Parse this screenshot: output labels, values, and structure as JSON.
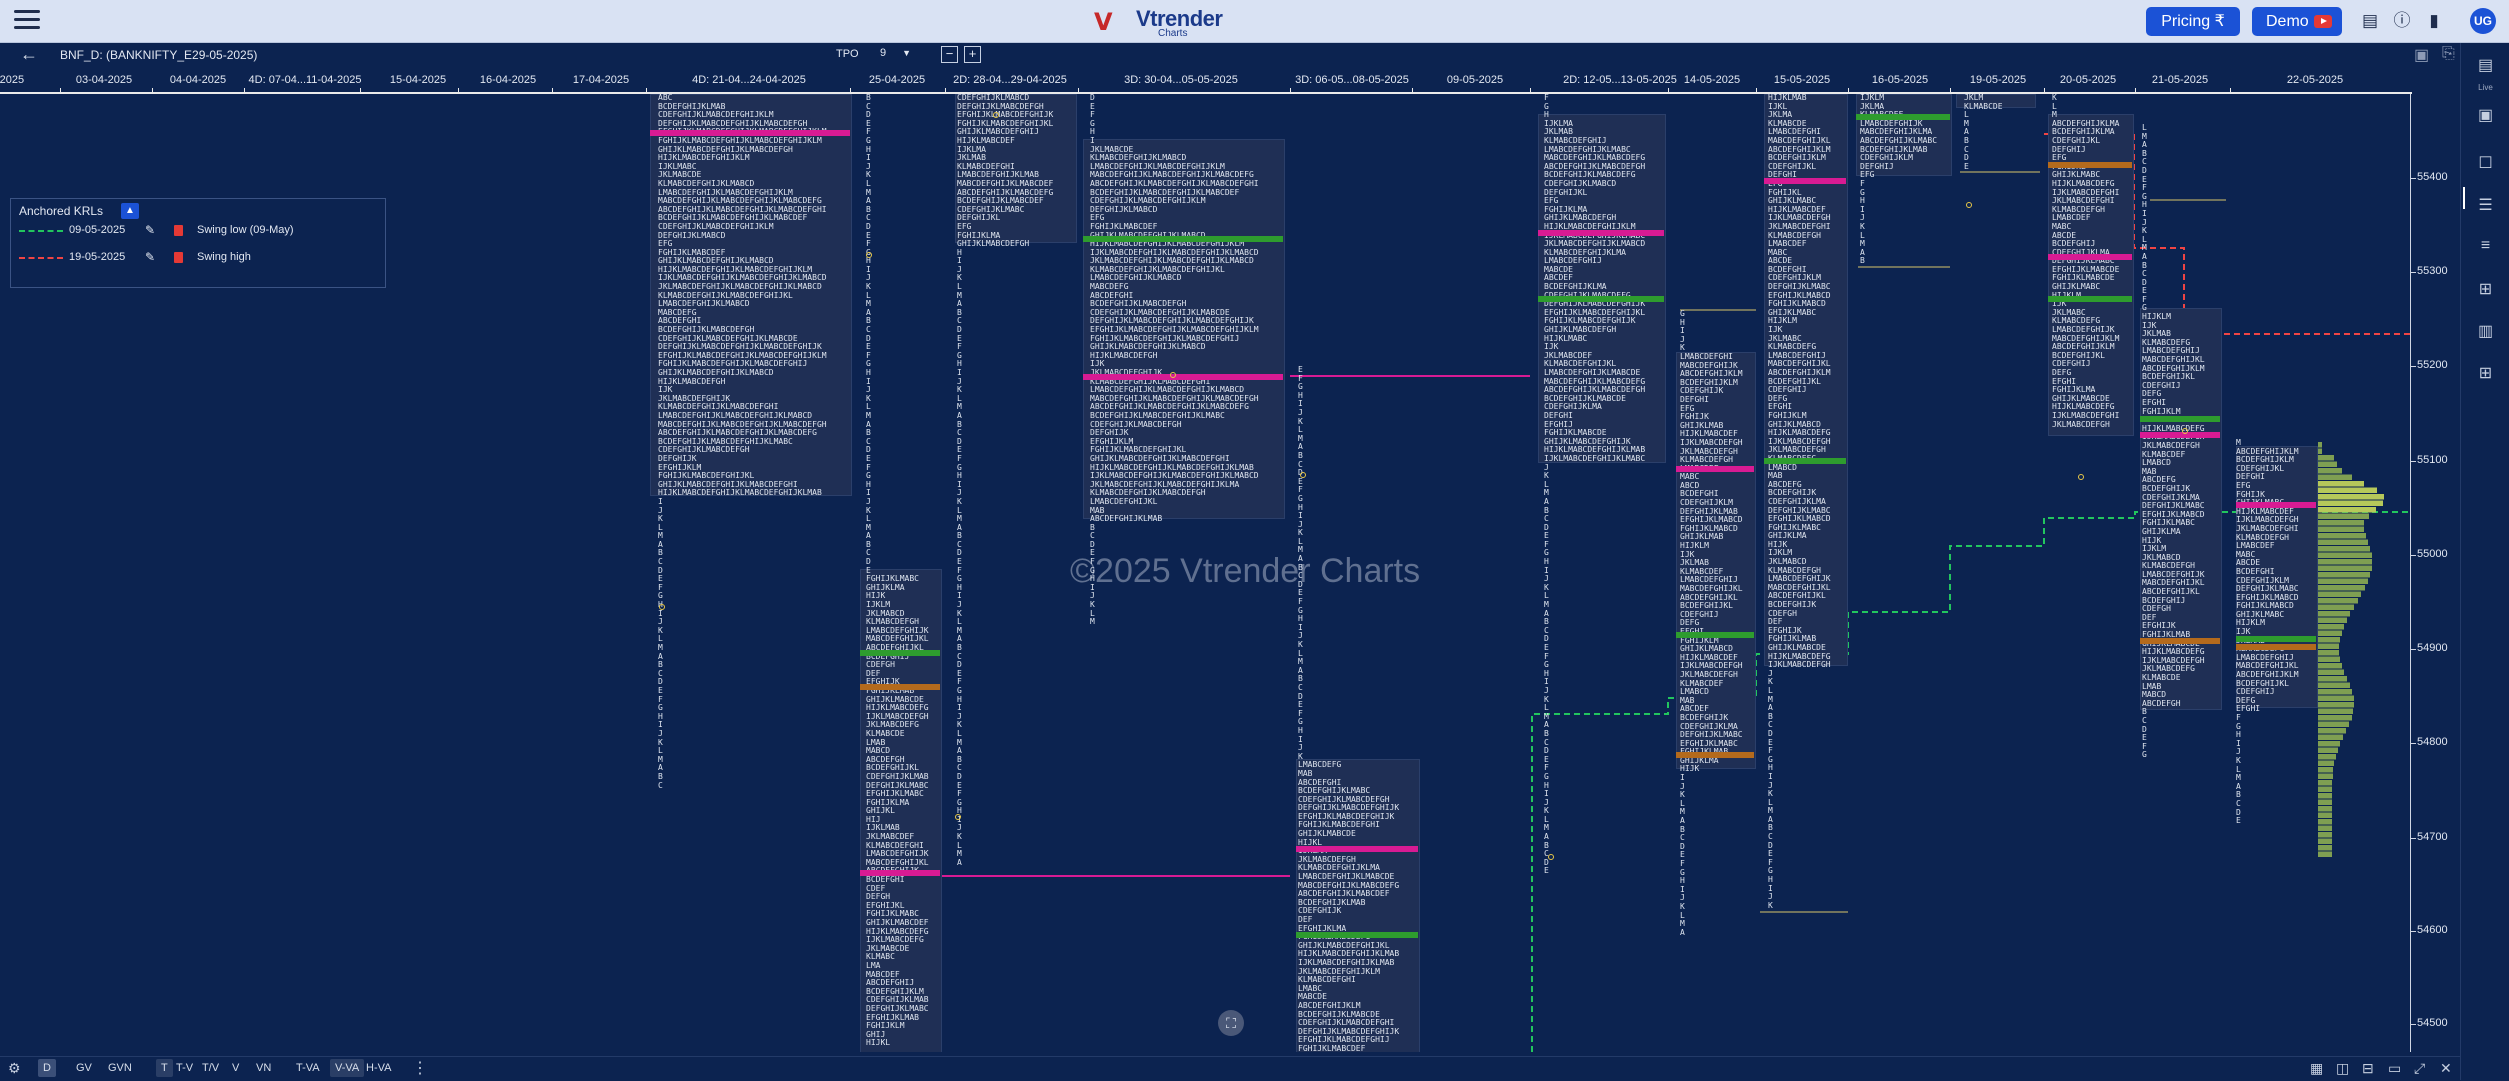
{
  "header": {
    "logo_name": "Vtrender",
    "logo_sub": "Charts",
    "pricing_label": "Pricing ₹",
    "demo_label": "Demo",
    "avatar_initials": "UG"
  },
  "toolbar": {
    "symbol": "BNF_D: (BANKNIFTY_E29-05-2025)",
    "tpo_label": "TPO",
    "tpo_value": "9",
    "minus": "−",
    "plus": "+"
  },
  "dates": [
    "-2025",
    "03-04-2025",
    "04-04-2025",
    "4D: 07-04...11-04-2025",
    "15-04-2025",
    "16-04-2025",
    "17-04-2025",
    "4D: 21-04...24-04-2025",
    "25-04-2025",
    "2D: 28-04...29-04-2025",
    "3D: 30-04...05-05-2025",
    "3D: 06-05...08-05-2025",
    "09-05-2025",
    "2D: 12-05...13-05-2025",
    "14-05-2025",
    "15-05-2025",
    "16-05-2025",
    "19-05-2025",
    "20-05-2025",
    "21-05-2025",
    "22-05-2025"
  ],
  "price_axis": [
    "55400",
    "55300",
    "55200",
    "55100",
    "55000",
    "54900",
    "54800",
    "54700",
    "54600",
    "54500"
  ],
  "watermark": "©2025 Vtrender Charts",
  "krl": {
    "title": "Anchored KRLs",
    "lines": [
      {
        "date": "09-05-2025",
        "name": "Swing low (09-May)",
        "color": "#22c55e"
      },
      {
        "date": "19-05-2025",
        "name": "Swing high",
        "color": "#ef4444"
      }
    ]
  },
  "bottombar": {
    "items": [
      "D",
      "GV",
      "GVN",
      "T",
      "T-V",
      "T/V",
      "V",
      "VN",
      "T-VA",
      "V-VA",
      "H-VA"
    ],
    "active": "D"
  },
  "sidebar": {
    "live_label": "Live"
  },
  "colors": {
    "background": "#0c2350",
    "profile": "#1f2f55",
    "poc": "#d81b93",
    "value_area_hi_lo": "#2e9c2e",
    "ib": "#b46a1c",
    "swing_low_line": "#22c55e",
    "swing_high_line": "#ef4444",
    "volume_profile": "#8fb35a"
  },
  "icons": [
    "hamburger-icon",
    "back-arrow-icon",
    "document-icon",
    "info-icon",
    "bookmark-icon",
    "save-icon",
    "share-icon",
    "fullscreen-icon",
    "settings-icon",
    "more-icon"
  ]
}
